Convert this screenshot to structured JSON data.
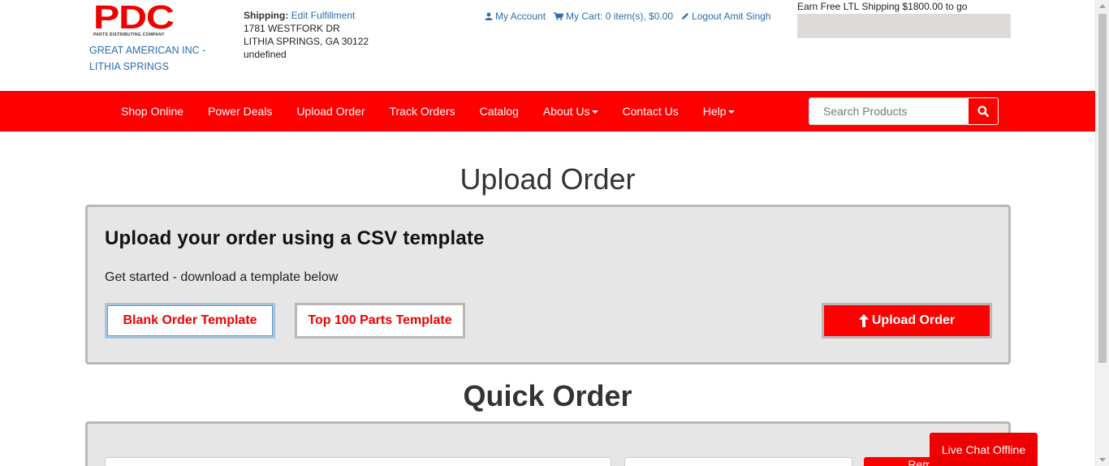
{
  "header": {
    "logo_text": "PDC",
    "logo_tagline": "PARTS DISTRIBUTING COMPANY",
    "company_name": "GREAT AMERICAN INC - LITHIA SPRINGS",
    "shipping_label": "Shipping:",
    "shipping_edit_link": "Edit Fulfillment",
    "address_line1": "1781 WESTFORK DR",
    "address_line2": "LITHIA SPRINGS, GA 30122",
    "address_line3": "undefined",
    "my_account": "My Account",
    "my_cart": "My Cart: 0 item(s), $0.00",
    "logout": "Logout Amit Singh",
    "ltl_text": "Earn Free LTL Shipping $1800.00 to go",
    "ltl_progress": 0
  },
  "nav": {
    "items": [
      {
        "label": "Shop Online",
        "dropdown": false
      },
      {
        "label": "Power Deals",
        "dropdown": false
      },
      {
        "label": "Upload Order",
        "dropdown": false
      },
      {
        "label": "Track Orders",
        "dropdown": false
      },
      {
        "label": "Catalog",
        "dropdown": false
      },
      {
        "label": "About Us",
        "dropdown": true
      },
      {
        "label": "Contact Us",
        "dropdown": false
      },
      {
        "label": "Help",
        "dropdown": true
      }
    ],
    "search_placeholder": "Search Products"
  },
  "upload": {
    "heading": "Upload Order",
    "panel_title": "Upload your order using a CSV template",
    "subtitle": "Get started - download a template below",
    "blank_template_btn": "Blank Order Template",
    "top100_template_btn": "Top 100 Parts Template",
    "upload_btn": "Upload Order"
  },
  "quick": {
    "heading": "Quick Order",
    "button_label": "Rem..."
  },
  "livechat": "Live Chat Offline",
  "colors": {
    "brand_red": "#ff0000",
    "link_blue": "#2a6fb0",
    "panel_bg": "#e6e6e6",
    "panel_border": "#b9b8b6"
  }
}
